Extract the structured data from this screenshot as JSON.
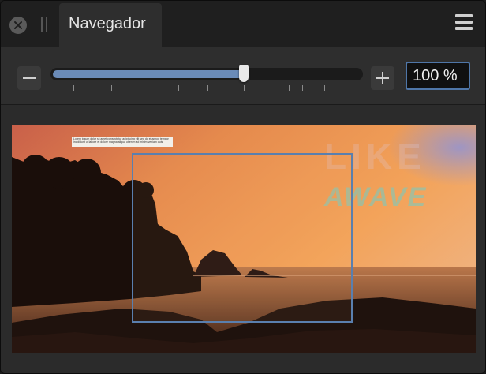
{
  "panel": {
    "tab_title": "Navegador"
  },
  "zoom": {
    "value_text": "100 %",
    "slider_fraction": 0.62
  },
  "preview": {
    "caption_lines": [
      "Lorem ipsum dolor sit amet consectetur adipiscing elit sed do eiusmod tempor",
      "incididunt ut labore et dolore magna aliqua ut enim ad minim veniam quis"
    ],
    "logo_line1": "LIKE",
    "logo_line2": "AWAVE"
  },
  "icons": {
    "close": "close-icon",
    "grip": "drag-handle-icon",
    "menu": "hamburger-menu-icon",
    "minus": "minus-icon",
    "plus": "plus-icon"
  },
  "colors": {
    "accent": "#6a8bb8",
    "viewport_outline": "#5a7fae",
    "panel_bg": "#2a2a2a"
  }
}
